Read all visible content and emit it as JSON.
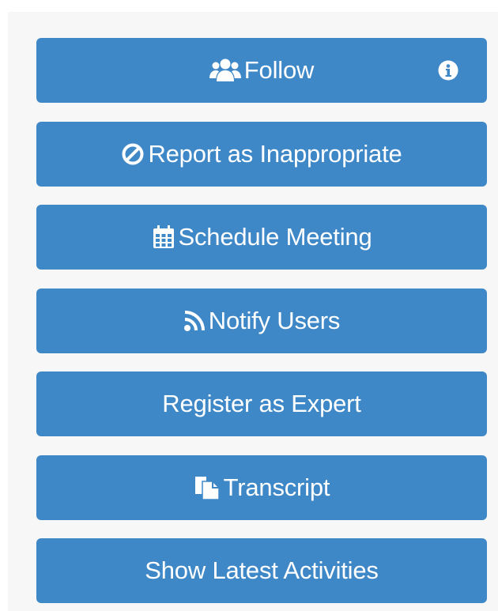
{
  "colors": {
    "button_bg": "#3f88c8",
    "button_text": "#ffffff",
    "panel_bg": "#f7f7f7"
  },
  "buttons": [
    {
      "label": "Follow",
      "icon": "users-icon",
      "extra_icon": "info-icon"
    },
    {
      "label": "Report as Inappropriate",
      "icon": "ban-icon"
    },
    {
      "label": "Schedule Meeting",
      "icon": "calendar-icon"
    },
    {
      "label": "Notify Users",
      "icon": "rss-icon"
    },
    {
      "label": "Register as Expert",
      "icon": ""
    },
    {
      "label": "Transcript",
      "icon": "copy-icon"
    },
    {
      "label": "Show Latest Activities",
      "icon": ""
    }
  ]
}
